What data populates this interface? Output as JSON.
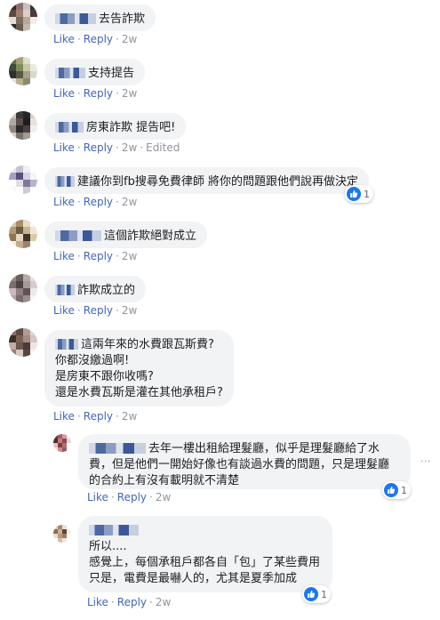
{
  "actions": {
    "like": "Like",
    "reply": "Reply",
    "separator": "·",
    "edited": "Edited"
  },
  "more_glyph": "···",
  "comments": [
    {
      "text": "去告詐欺",
      "time": "2w",
      "avatar": [
        "#3a2a2a",
        "#8a7070",
        "#c9c0c0",
        "#2c3a2e",
        "#5b4a40",
        "#a08070",
        "#d9cfc6",
        "#4a3a3a",
        "#e6dcd6",
        "#7d6b60",
        "#b9a89a",
        "#f0ece8",
        "#2d2d2d",
        "#6a5a50",
        "#c4b6aa",
        "#ffffff"
      ]
    },
    {
      "text": "支持提告",
      "time": "2w",
      "avatar": [
        "#6b6b48",
        "#a6a17a",
        "#e0ddc9",
        "#ffffff",
        "#3c4d3a",
        "#7d8c5e",
        "#c9c7a8",
        "#eaeadf",
        "#2f2f2f",
        "#595945",
        "#a3a38a",
        "#d9d9cc",
        "#e6e2d0",
        "#b8b08c",
        "#8a8a70",
        "#ffffff"
      ]
    },
    {
      "text": "房東詐欺 提告吧!",
      "time": "2w",
      "edited": true,
      "avatar": [
        "#cfc8c2",
        "#3a3a3a",
        "#262626",
        "#d6d0cc",
        "#b0a8a2",
        "#5b4e48",
        "#1e1e1e",
        "#e8e2de",
        "#8f8680",
        "#2a2a2a",
        "#4a4040",
        "#f2eeeb",
        "#d1c9c4",
        "#7a716c",
        "#a29a94",
        "#ffffff"
      ]
    },
    {
      "text": "建議你到fb搜尋免費律師 將你的問題跟他們說再做決定",
      "time": "2w",
      "reactions": "1",
      "avatar": [
        "#e8e6ee",
        "#c7c2d6",
        "#efeff4",
        "#ffffff",
        "#a89fc0",
        "#5b4f7a",
        "#d8d3e2",
        "#f5f5f8",
        "#ffffff",
        "#e2dde9",
        "#7f7898",
        "#b9b4c9",
        "#f7f7fa",
        "#ffffff",
        "#cfcadb",
        "#ffffff"
      ]
    },
    {
      "text": "這個詐欺絕對成立",
      "time": "2w",
      "avatar": [
        "#d6c7a8",
        "#a88e6a",
        "#e9dcc4",
        "#fbf7ef",
        "#b59a74",
        "#6b5a44",
        "#c9b391",
        "#f1e7d4",
        "#8c7656",
        "#e4d7bd",
        "#3e3428",
        "#d9c9a9",
        "#f6efe2",
        "#c2ad8a",
        "#9a8464",
        "#ffffff"
      ]
    },
    {
      "text": "詐欺成立的",
      "time": "2w",
      "avatar": [
        "#9a8a8a",
        "#6a5e5e",
        "#b8aaa8",
        "#e6dede",
        "#7d6e6e",
        "#4e4444",
        "#a8999a",
        "#d6cccc",
        "#c9bcbc",
        "#8f8080",
        "#5e5353",
        "#eee8e8",
        "#b3a5a5",
        "#7a6c6c",
        "#9c8e8e",
        "#f5f2f2"
      ]
    },
    {
      "lines": [
        "這兩年來的水費跟瓦斯費?",
        "你都沒繳過啊!",
        "是房東不跟你收嗎?",
        "還是水費瓦斯是灌在其他承租戶?"
      ],
      "time": "2w",
      "avatar": [
        "#8c6f6a",
        "#5e4a45",
        "#b59a94",
        "#e2d4d0",
        "#3a2d2a",
        "#7a5f5a",
        "#a88a84",
        "#d6c6c2",
        "#c4aaa4",
        "#6e5650",
        "#4a3a36",
        "#efe6e4",
        "#9a7c76",
        "#d9c7c3",
        "#5a4540",
        "#f8f3f2"
      ]
    },
    {
      "lines": [
        "去年一樓出租給理髮廳，似乎是理髮廳給了水",
        "費，但是他們一開始好像也有談過水費的問題，只是理髮廳",
        "的合約上有沒有載明就不清楚"
      ],
      "time": "2w",
      "reactions": "1",
      "reply": true,
      "avatar": [
        "#6a3a3e",
        "#a85a62",
        "#d99aa0",
        "#f3e1e3",
        "#4a2a2d",
        "#c97a82",
        "#8c4a50",
        "#ecd2d5",
        "#e6c0c4",
        "#7a3e44",
        "#b86a72",
        "#ffffff",
        "#f0d8da",
        "#c98a90",
        "#9a5a60",
        "#ffffff"
      ]
    },
    {
      "lines": [
        "所以....",
        "感覺上，每個承租戶都各自「包」了某些費用",
        "只是，電費是最嚇人的，尤其是夏季加成"
      ],
      "time": "2w",
      "reactions": "1",
      "reply": true,
      "avatar": [
        "#d8c8b8",
        "#a68a6e",
        "#ecdfd2",
        "#ffffff",
        "#8a6a4e",
        "#c7b29c",
        "#5e4634",
        "#f3ebe3",
        "#e9dccd",
        "#b69a7e",
        "#9c7e62",
        "#ffffff",
        "#fdfaf7",
        "#d4c0aa",
        "#f0e6db",
        "#ffffff"
      ]
    }
  ]
}
